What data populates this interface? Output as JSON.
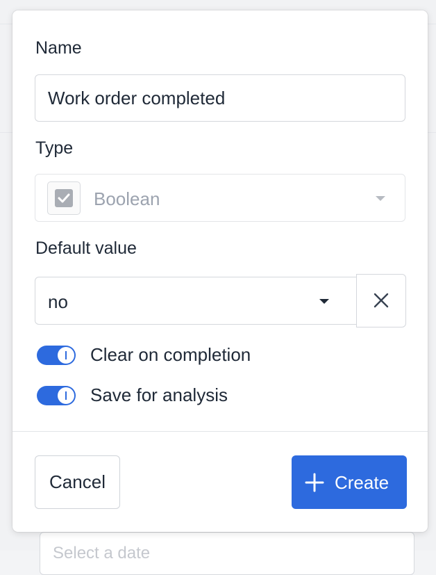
{
  "background": {
    "input_placeholder": "Select a date"
  },
  "form": {
    "name_label": "Name",
    "name_value": "Work order completed",
    "type_label": "Type",
    "type_value": "Boolean",
    "type_icon": "checkbox-icon",
    "default_label": "Default value",
    "default_value": "no",
    "clear_icon": "close-icon"
  },
  "toggles": [
    {
      "label": "Clear on completion",
      "on": true
    },
    {
      "label": "Save for analysis",
      "on": true
    }
  ],
  "footer": {
    "cancel_label": "Cancel",
    "create_label": "Create",
    "create_icon": "plus-icon"
  },
  "colors": {
    "accent": "#2d6ade",
    "text": "#1f2937",
    "muted_text": "#9ca3af",
    "border": "#d4d7dc"
  }
}
